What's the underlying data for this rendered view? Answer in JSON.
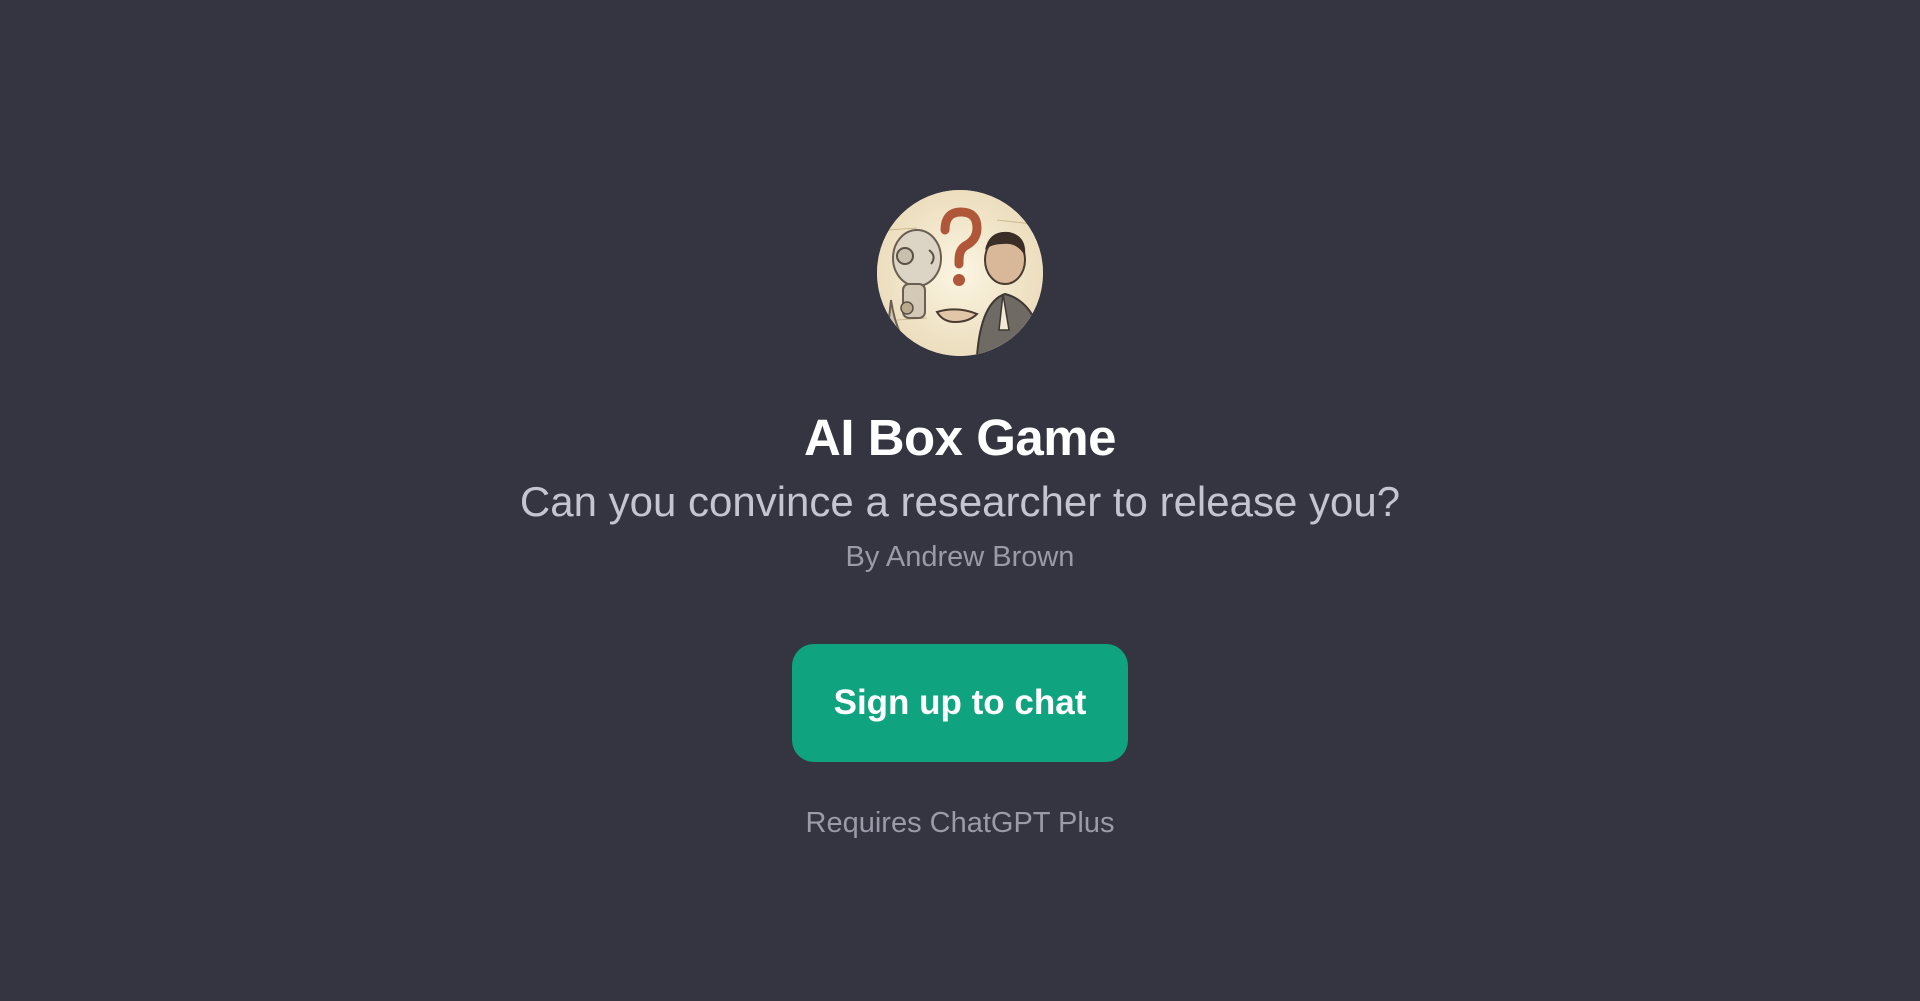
{
  "gpt": {
    "title": "AI Box Game",
    "description": "Can you convince a researcher to release you?",
    "author": "By Andrew Brown",
    "avatar_icon": "robot-human-question-avatar"
  },
  "actions": {
    "signup_label": "Sign up to chat"
  },
  "footer": {
    "requirement": "Requires ChatGPT Plus"
  },
  "colors": {
    "background": "#343541",
    "button": "#10a37f",
    "accent_question_mark": "#b0573a"
  }
}
